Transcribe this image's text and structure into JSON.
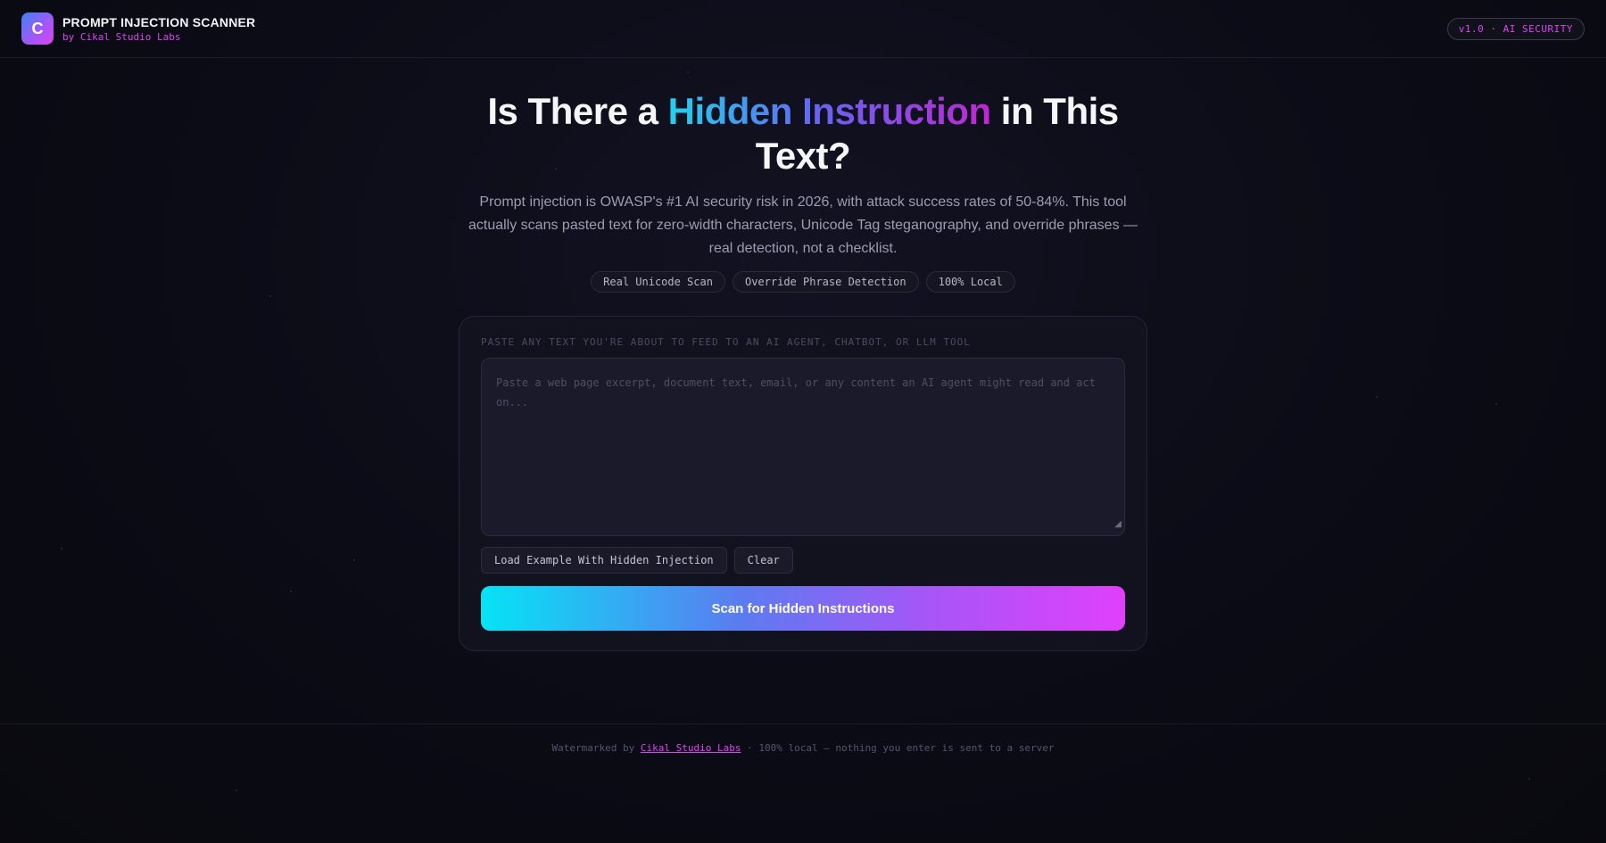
{
  "header": {
    "logo_letter": "C",
    "title": "PROMPT INJECTION SCANNER",
    "subtitle": "by Cikal Studio Labs",
    "version_badge": "v1.0 · AI SECURITY"
  },
  "hero": {
    "headline_before": "Is There a ",
    "headline_highlight": "Hidden Instruction",
    "headline_after": " in This Text?",
    "description": "Prompt injection is OWASP's #1 AI security risk in 2026, with attack success rates of 50-84%. This tool actually scans pasted text for zero-width characters, Unicode Tag steganography, and override phrases — real detection, not a checklist.",
    "tags": [
      "Real Unicode Scan",
      "Override Phrase Detection",
      "100% Local"
    ]
  },
  "scanner": {
    "label": "PASTE ANY TEXT YOU'RE ABOUT TO FEED TO AN AI AGENT, CHATBOT, OR LLM TOOL",
    "input_value": "",
    "input_placeholder": "Paste a web page excerpt, document text, email, or any content an AI agent might read and act on...",
    "load_example_label": "Load Example With Hidden Injection",
    "clear_label": "Clear",
    "scan_label": "Scan for Hidden Instructions"
  },
  "footer": {
    "prefix": "Watermarked by ",
    "link_text": "Cikal Studio Labs",
    "suffix": " · 100% local — nothing you enter is sent to a server"
  },
  "colors": {
    "background": "#0b0b15",
    "accent_magenta": "#d946ef",
    "accent_cyan": "#06e3f5",
    "accent_purple": "#a855f7"
  }
}
